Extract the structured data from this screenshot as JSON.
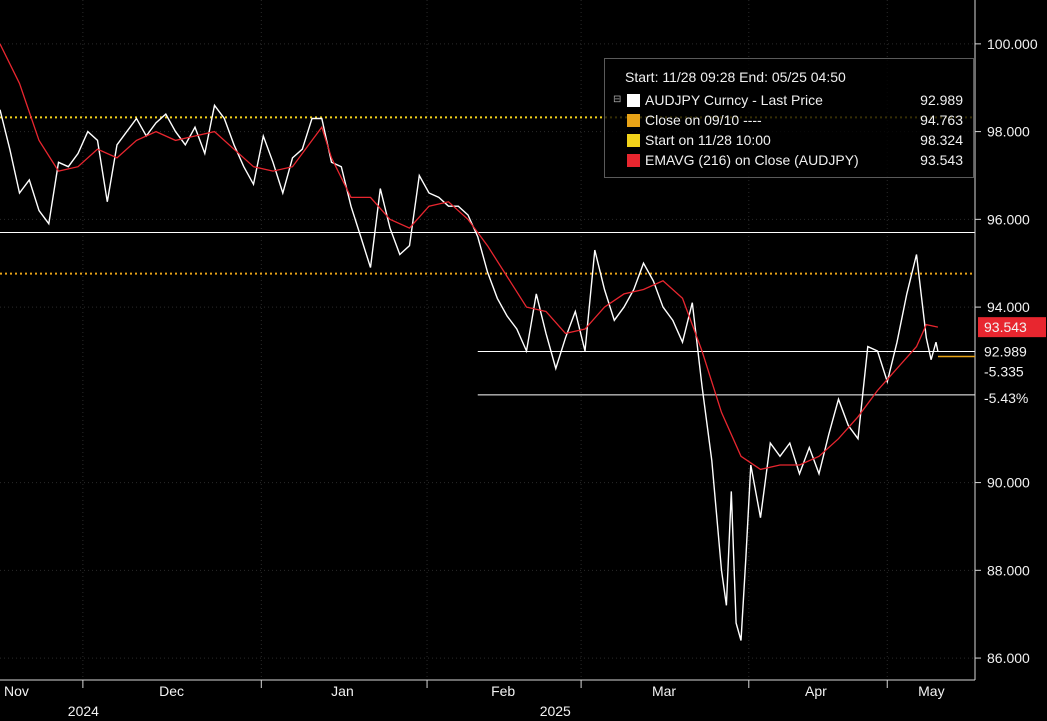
{
  "chart_data": {
    "type": "line",
    "ylim": [
      85.5,
      101
    ],
    "y_ticks": [
      "100.000",
      "98.000",
      "96.000",
      "94.000",
      "90.000",
      "88.000",
      "86.000"
    ],
    "y_tick_values": [
      100,
      98,
      96,
      94,
      90,
      88,
      86
    ],
    "months": [
      {
        "label": "Nov",
        "x": 0
      },
      {
        "label": "Dec",
        "x": 0.085
      },
      {
        "label": "Jan",
        "x": 0.268
      },
      {
        "label": "Feb",
        "x": 0.438
      },
      {
        "label": "Mar",
        "x": 0.596
      },
      {
        "label": "Apr",
        "x": 0.768
      },
      {
        "label": "May",
        "x": 0.91
      }
    ],
    "years": [
      {
        "label": "2024",
        "x": 0.088
      },
      {
        "label": "2025",
        "x": 0.572
      }
    ],
    "price_series": {
      "name": "AUDJPY Curncy - Last Price",
      "color": "#ffffff",
      "points": [
        [
          0.0,
          98.5
        ],
        [
          0.01,
          97.6
        ],
        [
          0.02,
          96.6
        ],
        [
          0.03,
          96.9
        ],
        [
          0.04,
          96.2
        ],
        [
          0.05,
          95.9
        ],
        [
          0.06,
          97.3
        ],
        [
          0.07,
          97.2
        ],
        [
          0.08,
          97.5
        ],
        [
          0.09,
          98.0
        ],
        [
          0.1,
          97.8
        ],
        [
          0.11,
          96.4
        ],
        [
          0.12,
          97.7
        ],
        [
          0.13,
          98.0
        ],
        [
          0.14,
          98.3
        ],
        [
          0.15,
          97.9
        ],
        [
          0.16,
          98.2
        ],
        [
          0.17,
          98.4
        ],
        [
          0.18,
          98.0
        ],
        [
          0.19,
          97.7
        ],
        [
          0.2,
          98.1
        ],
        [
          0.21,
          97.5
        ],
        [
          0.22,
          98.6
        ],
        [
          0.23,
          98.3
        ],
        [
          0.24,
          97.7
        ],
        [
          0.25,
          97.2
        ],
        [
          0.26,
          96.8
        ],
        [
          0.27,
          97.9
        ],
        [
          0.28,
          97.3
        ],
        [
          0.29,
          96.6
        ],
        [
          0.3,
          97.4
        ],
        [
          0.31,
          97.6
        ],
        [
          0.32,
          98.3
        ],
        [
          0.33,
          98.3
        ],
        [
          0.34,
          97.3
        ],
        [
          0.35,
          97.2
        ],
        [
          0.36,
          96.3
        ],
        [
          0.37,
          95.6
        ],
        [
          0.38,
          94.9
        ],
        [
          0.39,
          96.7
        ],
        [
          0.4,
          95.8
        ],
        [
          0.41,
          95.2
        ],
        [
          0.42,
          95.4
        ],
        [
          0.43,
          97.0
        ],
        [
          0.44,
          96.6
        ],
        [
          0.45,
          96.5
        ],
        [
          0.46,
          96.3
        ],
        [
          0.47,
          96.3
        ],
        [
          0.48,
          96.1
        ],
        [
          0.49,
          95.6
        ],
        [
          0.5,
          94.8
        ],
        [
          0.51,
          94.2
        ],
        [
          0.52,
          93.8
        ],
        [
          0.53,
          93.5
        ],
        [
          0.54,
          93.0
        ],
        [
          0.55,
          94.3
        ],
        [
          0.56,
          93.4
        ],
        [
          0.57,
          92.6
        ],
        [
          0.58,
          93.3
        ],
        [
          0.59,
          93.9
        ],
        [
          0.6,
          93.0
        ],
        [
          0.61,
          95.3
        ],
        [
          0.62,
          94.4
        ],
        [
          0.63,
          93.7
        ],
        [
          0.64,
          94.0
        ],
        [
          0.65,
          94.4
        ],
        [
          0.66,
          95.0
        ],
        [
          0.67,
          94.6
        ],
        [
          0.68,
          94.0
        ],
        [
          0.69,
          93.7
        ],
        [
          0.7,
          93.2
        ],
        [
          0.71,
          94.1
        ],
        [
          0.72,
          92.2
        ],
        [
          0.73,
          90.5
        ],
        [
          0.74,
          88.0
        ],
        [
          0.745,
          87.2
        ],
        [
          0.75,
          89.8
        ],
        [
          0.755,
          86.8
        ],
        [
          0.76,
          86.4
        ],
        [
          0.765,
          88.3
        ],
        [
          0.77,
          90.4
        ],
        [
          0.78,
          89.2
        ],
        [
          0.79,
          90.9
        ],
        [
          0.8,
          90.6
        ],
        [
          0.81,
          90.9
        ],
        [
          0.82,
          90.2
        ],
        [
          0.83,
          90.8
        ],
        [
          0.84,
          90.2
        ],
        [
          0.85,
          91.1
        ],
        [
          0.86,
          91.9
        ],
        [
          0.87,
          91.3
        ],
        [
          0.88,
          91.0
        ],
        [
          0.89,
          93.1
        ],
        [
          0.9,
          93.0
        ],
        [
          0.91,
          92.3
        ],
        [
          0.92,
          93.2
        ],
        [
          0.93,
          94.3
        ],
        [
          0.94,
          95.2
        ],
        [
          0.95,
          93.3
        ],
        [
          0.955,
          92.8
        ],
        [
          0.96,
          93.2
        ],
        [
          0.962,
          92.989
        ]
      ]
    },
    "ema_series": {
      "name": "EMAVG (216)  on Close (AUDJPY)",
      "color": "#e8262f",
      "points": [
        [
          0.0,
          100.0
        ],
        [
          0.02,
          99.1
        ],
        [
          0.04,
          97.8
        ],
        [
          0.06,
          97.1
        ],
        [
          0.08,
          97.2
        ],
        [
          0.1,
          97.6
        ],
        [
          0.12,
          97.4
        ],
        [
          0.14,
          97.8
        ],
        [
          0.16,
          98.0
        ],
        [
          0.18,
          97.8
        ],
        [
          0.2,
          97.9
        ],
        [
          0.22,
          98.0
        ],
        [
          0.24,
          97.6
        ],
        [
          0.26,
          97.2
        ],
        [
          0.28,
          97.1
        ],
        [
          0.3,
          97.2
        ],
        [
          0.32,
          97.8
        ],
        [
          0.33,
          98.1
        ],
        [
          0.34,
          97.4
        ],
        [
          0.36,
          96.5
        ],
        [
          0.38,
          96.5
        ],
        [
          0.4,
          96.0
        ],
        [
          0.42,
          95.8
        ],
        [
          0.44,
          96.3
        ],
        [
          0.46,
          96.4
        ],
        [
          0.48,
          96.0
        ],
        [
          0.5,
          95.4
        ],
        [
          0.52,
          94.7
        ],
        [
          0.54,
          94.0
        ],
        [
          0.56,
          93.9
        ],
        [
          0.58,
          93.4
        ],
        [
          0.6,
          93.5
        ],
        [
          0.62,
          94.0
        ],
        [
          0.64,
          94.3
        ],
        [
          0.66,
          94.4
        ],
        [
          0.68,
          94.6
        ],
        [
          0.7,
          94.2
        ],
        [
          0.72,
          93.0
        ],
        [
          0.74,
          91.6
        ],
        [
          0.76,
          90.6
        ],
        [
          0.78,
          90.3
        ],
        [
          0.8,
          90.4
        ],
        [
          0.82,
          90.4
        ],
        [
          0.84,
          90.6
        ],
        [
          0.86,
          91.0
        ],
        [
          0.88,
          91.5
        ],
        [
          0.9,
          92.1
        ],
        [
          0.92,
          92.6
        ],
        [
          0.94,
          93.1
        ],
        [
          0.95,
          93.6
        ],
        [
          0.962,
          93.543
        ]
      ]
    },
    "lines": [
      {
        "type": "close-level",
        "color": "#e8a317",
        "value": 94.763,
        "style": "dotted"
      },
      {
        "type": "start-level",
        "color": "#f2d21a",
        "value": 98.324,
        "style": "dotted"
      },
      {
        "type": "horizontal-white",
        "color": "#ffffff",
        "value": 95.7,
        "x_start": 0
      },
      {
        "type": "horizontal-white",
        "color": "#ffffff",
        "value": 92.989,
        "x_start": 0.49
      },
      {
        "type": "horizontal-white",
        "color": "#ffffff",
        "value": 92.0,
        "x_start": 0.49
      }
    ],
    "right_labels": {
      "ema_tag": "93.543",
      "last_price": "92.989",
      "change": "-5.335",
      "change_pct": "-5.43%"
    },
    "legend": {
      "header": "Start: 11/28 09:28 End: 05/25 04:50",
      "collapse_icon": "⊟",
      "rows": [
        {
          "label": "AUDJPY Curncy - Last Price",
          "value": "92.989",
          "color": "#ffffff"
        },
        {
          "label": "Close on 09/10 ----",
          "value": "94.763",
          "color": "#e8a317"
        },
        {
          "label": "Start on 11/28 10:00",
          "value": "98.324",
          "color": "#f2d21a"
        },
        {
          "label": "EMAVG (216)  on Close (AUDJPY)",
          "value": "93.543",
          "color": "#e8262f"
        }
      ]
    }
  }
}
